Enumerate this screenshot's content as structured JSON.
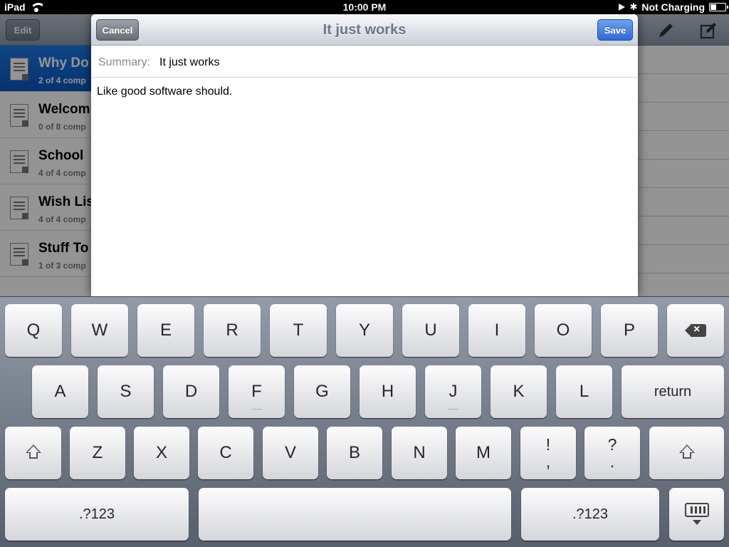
{
  "status_bar": {
    "device": "iPad",
    "time": "10:00 PM",
    "charging": "Not Charging",
    "battery_level": 0.4
  },
  "background": {
    "edit_label": "Edit",
    "lists": [
      {
        "title": "Why Do",
        "subtitle": "2 of 4 comp"
      },
      {
        "title": "Welcom",
        "subtitle": "0 of 8 comp"
      },
      {
        "title": "School",
        "subtitle": "4 of 4 comp"
      },
      {
        "title": "Wish Lis",
        "subtitle": "4 of 4 comp"
      },
      {
        "title": "Stuff To",
        "subtitle": "1 of 3 comp"
      }
    ]
  },
  "modal": {
    "title": "It just works",
    "cancel_label": "Cancel",
    "save_label": "Save",
    "summary_label": "Summary:",
    "summary_value": "It just works",
    "body_text": "Like good software should."
  },
  "keyboard": {
    "row1": [
      "Q",
      "W",
      "E",
      "R",
      "T",
      "Y",
      "U",
      "I",
      "O",
      "P"
    ],
    "row2": [
      "A",
      "S",
      "D",
      "F",
      "G",
      "H",
      "J",
      "K",
      "L"
    ],
    "return_label": "return",
    "row3": [
      "Z",
      "X",
      "C",
      "V",
      "B",
      "N",
      "M"
    ],
    "punct1": {
      "top": "!",
      "bottom": ","
    },
    "punct2": {
      "top": "?",
      "bottom": "."
    },
    "numbers_label": ".?123"
  },
  "colors": {
    "accent": "#2f68d6",
    "selection": "#0a57c2"
  }
}
